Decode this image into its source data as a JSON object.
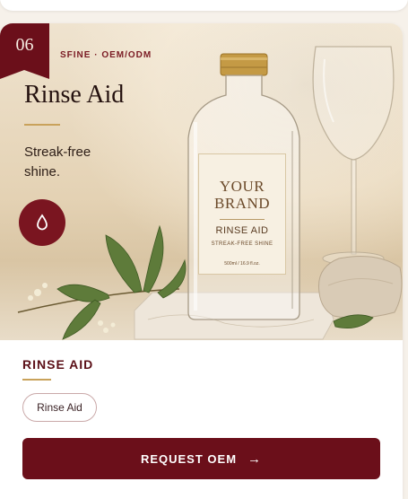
{
  "product": {
    "number": "06",
    "tag": "SFINE · OEM/ODM",
    "title": "Rinse Aid",
    "subtitle": "Streak-free shine.",
    "icon": "droplet-icon"
  },
  "bottle_label": {
    "brand_line1": "YOUR",
    "brand_line2": "BRAND",
    "product_name": "RINSE AID",
    "tagline": "STREAK-FREE SHINE",
    "volume": "500ml / 16.9 fl.oz."
  },
  "details": {
    "section_title": "RINSE AID",
    "chip_label": "Rinse Aid"
  },
  "cta": {
    "label": "REQUEST OEM",
    "arrow": "→"
  },
  "colors": {
    "brand_maroon": "#6b0f1a",
    "gold_accent": "#c9a25b",
    "hero_beige": "#e4d2b4"
  }
}
